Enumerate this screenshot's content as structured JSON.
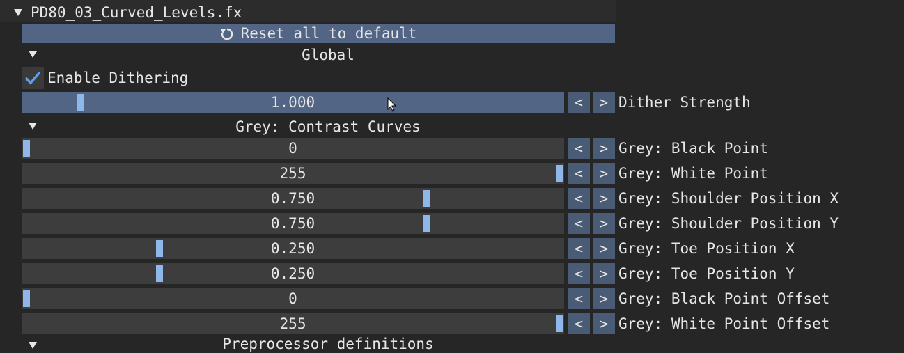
{
  "file": {
    "title": "PD80_03_Curved_Levels.fx"
  },
  "reset_label": "Reset all to default",
  "sections": {
    "global": "Global",
    "grey": "Grey: Contrast Curves",
    "pre": "Preprocessor definitions"
  },
  "global": {
    "dither_checkbox_label": "Enable Dithering",
    "dither_checked": true,
    "dither_strength": {
      "value": "1.000",
      "fraction": 0.1,
      "label": "Dither Strength"
    }
  },
  "grey_params": [
    {
      "value": "0",
      "fraction": 0.0,
      "label": "Grey: Black Point"
    },
    {
      "value": "255",
      "fraction": 1.0,
      "label": "Grey: White Point"
    },
    {
      "value": "0.750",
      "fraction": 0.75,
      "label": "Grey: Shoulder Position X"
    },
    {
      "value": "0.750",
      "fraction": 0.75,
      "label": "Grey: Shoulder Position Y"
    },
    {
      "value": "0.250",
      "fraction": 0.25,
      "label": "Grey: Toe Position X"
    },
    {
      "value": "0.250",
      "fraction": 0.25,
      "label": "Grey: Toe Position Y"
    },
    {
      "value": "0",
      "fraction": 0.0,
      "label": "Grey: Black Point Offset"
    },
    {
      "value": "255",
      "fraction": 1.0,
      "label": "Grey: White Point Offset"
    }
  ],
  "stepper": {
    "dec": "<",
    "inc": ">"
  },
  "colors": {
    "accent": "#526584",
    "knob": "#8eb7ea",
    "check": "#5aa0f0"
  }
}
